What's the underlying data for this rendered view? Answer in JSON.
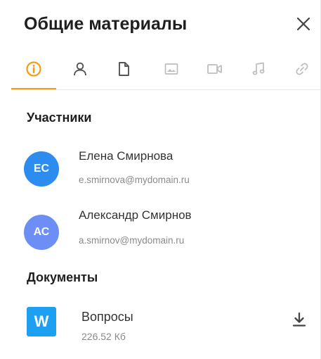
{
  "header": {
    "title": "Общие материалы",
    "close_icon": "close-icon"
  },
  "tabs": [
    {
      "icon": "info-icon",
      "active": true
    },
    {
      "icon": "person-icon",
      "active": false
    },
    {
      "icon": "document-icon",
      "active": false
    },
    {
      "icon": "image-icon",
      "active": false
    },
    {
      "icon": "video-icon",
      "active": false
    },
    {
      "icon": "music-icon",
      "active": false
    },
    {
      "icon": "link-icon",
      "active": false
    }
  ],
  "participants": {
    "title": "Участники",
    "items": [
      {
        "initials": "ЕС",
        "name": "Елена Смирнова",
        "email": "e.smirnova@mydomain.ru",
        "color": "#2d8cf0"
      },
      {
        "initials": "АС",
        "name": "Александр Смирнов",
        "email": "a.smirnov@mydomain.ru",
        "color": "#6d8ff5"
      }
    ]
  },
  "documents": {
    "title": "Документы",
    "items": [
      {
        "icon_letter": "W",
        "name": "Вопросы",
        "size": "226.52 Кб",
        "icon_color": "#1ea0f2",
        "action_icon": "download-icon"
      }
    ]
  },
  "colors": {
    "accent": "#f39c12",
    "inactive_icon": "#bdbdbd",
    "active_icon_dark": "#555555"
  }
}
